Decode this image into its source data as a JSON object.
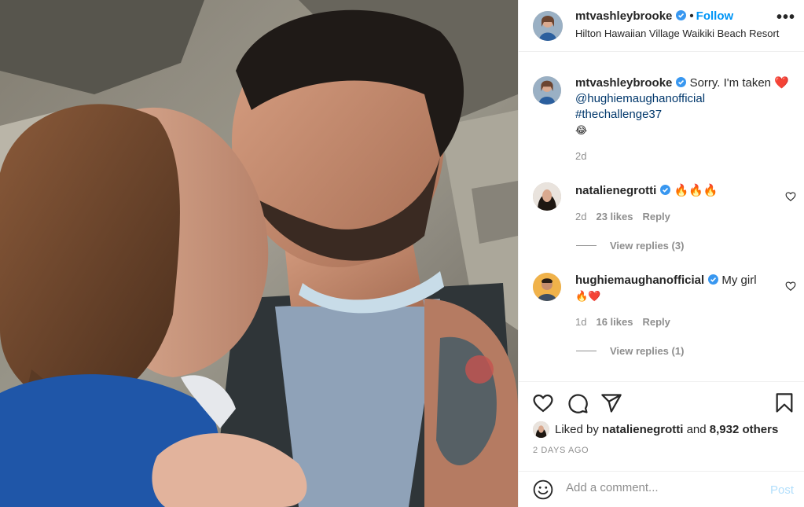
{
  "post": {
    "username": "mtvashleybrooke",
    "follow_label": "Follow",
    "dot": "•",
    "location": "Hilton Hawaiian Village Waikiki Beach Resort",
    "more": "•••"
  },
  "caption": {
    "username": "mtvashleybrooke",
    "text": "Sorry. I'm taken",
    "heart": "❤️",
    "mention": "@hughiemaughanofficial",
    "hashtag": "#thechallenge37",
    "emoji": "😂",
    "age": "2d"
  },
  "comments": [
    {
      "username": "natalienegrotti",
      "text": "🔥🔥🔥",
      "age": "2d",
      "likes": "23 likes",
      "reply": "Reply",
      "view_replies": "View replies (3)"
    },
    {
      "username": "hughiemaughanofficial",
      "text": "My girl",
      "text2": "🔥❤️",
      "age": "1d",
      "likes": "16 likes",
      "reply": "Reply",
      "view_replies": "View replies (1)"
    }
  ],
  "likes_summary": {
    "prefix": "Liked by ",
    "user": "natalienegrotti",
    "middle": " and ",
    "count": "8,932 others"
  },
  "timestamp": "2 DAYS AGO",
  "comment_box": {
    "placeholder": "Add a comment...",
    "post_label": "Post"
  },
  "icons": [
    "heart-icon",
    "comment-icon",
    "share-icon",
    "bookmark-icon",
    "emoji-icon",
    "verified-badge-icon",
    "more-options-icon"
  ],
  "colors": {
    "accent_blue": "#0095f6",
    "link_blue": "#00376b",
    "muted_gray": "#8e8e8e",
    "post_disabled": "#b2dffc",
    "verified_blue": "#3897f0"
  }
}
